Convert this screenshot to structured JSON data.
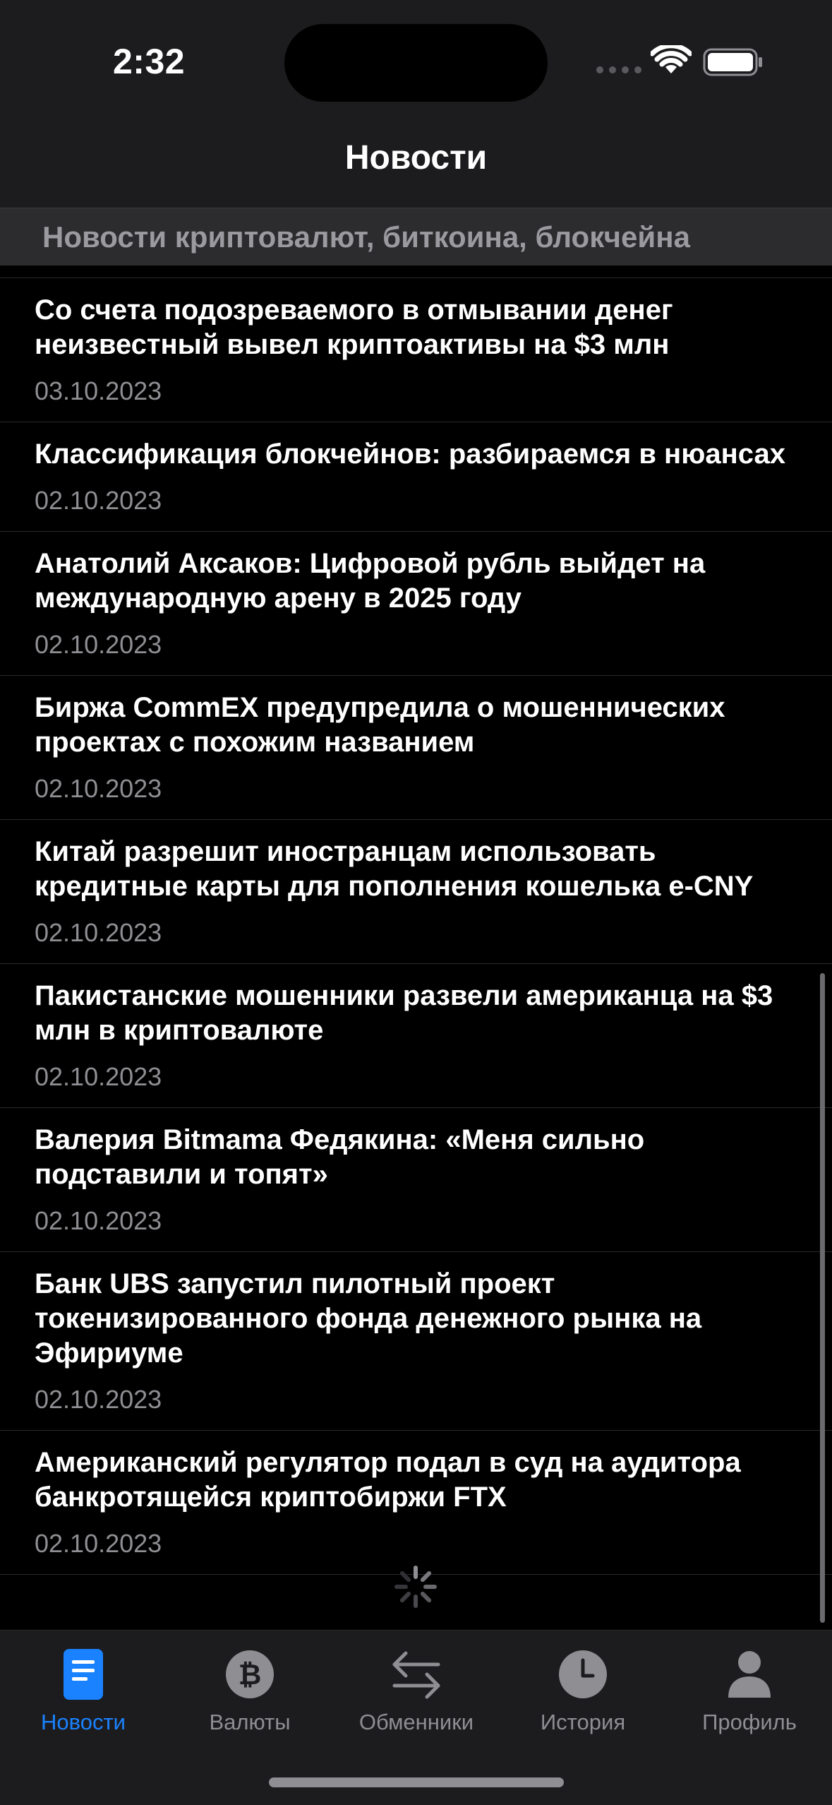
{
  "status_bar": {
    "time": "2:32"
  },
  "nav": {
    "title": "Новости"
  },
  "section": {
    "header": "Новости криптовалют, биткоина, блокчейна"
  },
  "news": [
    {
      "title": "Со счета подозреваемого в отмывании денег неизвестный вывел криптоактивы на $3 млн",
      "date": "03.10.2023"
    },
    {
      "title": "Классификация блокчейнов: разбираемся в нюансах",
      "date": "02.10.2023"
    },
    {
      "title": "Анатолий Аксаков: Цифровой рубль выйдет на международную арену в 2025 году",
      "date": "02.10.2023"
    },
    {
      "title": "Биржа CommEX предупредила о мошеннических проектах с похожим названием",
      "date": "02.10.2023"
    },
    {
      "title": "Китай разрешит иностранцам использовать кредитные карты для пополнения кошелька e-CNY",
      "date": "02.10.2023"
    },
    {
      "title": "Пакистанские мошенники развели американца на $3 млн в криптовалюте",
      "date": "02.10.2023"
    },
    {
      "title": "Валерия Bitmama Федякина: «Меня сильно подставили и топят»",
      "date": "02.10.2023"
    },
    {
      "title": "Банк UBS запустил пилотный проект токенизированного фонда денежного рынка на Эфириуме",
      "date": "02.10.2023"
    },
    {
      "title": "Американский регулятор подал в суд на аудитора банкротящейся криптобиржи FTX",
      "date": "02.10.2023"
    }
  ],
  "tabs": [
    {
      "label": "Новости",
      "icon": "news-icon",
      "active": true
    },
    {
      "label": "Валюты",
      "icon": "bitcoin-icon",
      "active": false
    },
    {
      "label": "Обменники",
      "icon": "exchange-arrows-icon",
      "active": false
    },
    {
      "label": "История",
      "icon": "clock-icon",
      "active": false
    },
    {
      "label": "Профиль",
      "icon": "person-icon",
      "active": false
    }
  ],
  "colors": {
    "accent": "#1a82ff",
    "secondary_text": "#8e8e93",
    "bar_background": "#1c1c1e"
  }
}
